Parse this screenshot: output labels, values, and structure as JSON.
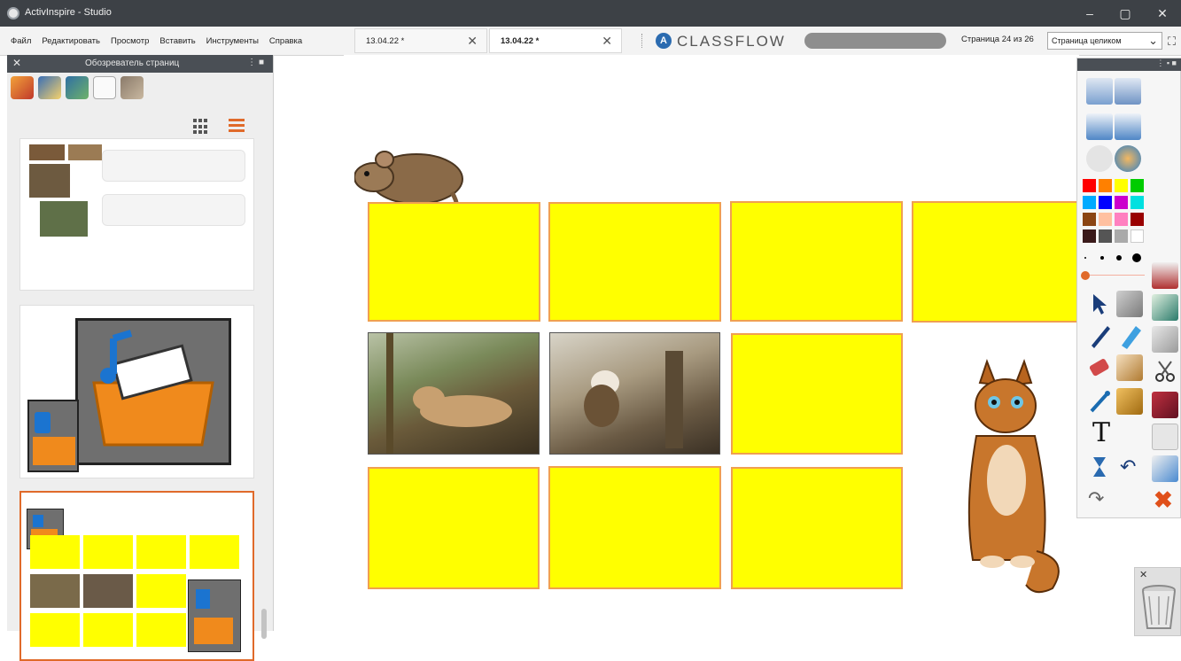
{
  "window": {
    "title": "ActivInspire - Studio",
    "controls": {
      "minimize": "–",
      "maximize": "▢",
      "close": "✕"
    }
  },
  "menu": {
    "items": [
      {
        "label": "Файл"
      },
      {
        "label": "Редактировать"
      },
      {
        "label": "Просмотр"
      },
      {
        "label": "Вставить"
      },
      {
        "label": "Инструменты"
      },
      {
        "label": "Справка"
      }
    ]
  },
  "tabs": [
    {
      "label": "13.04.22 *",
      "close": "✕",
      "active": false
    },
    {
      "label": "13.04.22 *",
      "close": "✕",
      "active": true
    }
  ],
  "classflow": {
    "logo_text": "CLASSFLOW",
    "logo_glyph": "A"
  },
  "status": {
    "page_text": "Страница 24 из 26",
    "zoom_value": "Страница целиком"
  },
  "sidebar": {
    "title": "Обозреватель страниц",
    "close": "✕",
    "pin": "⋮ ■",
    "tool_icons": [
      "page-browser-icon",
      "resource-browser-icon",
      "object-browser-icon",
      "notes-browser-icon",
      "property-browser-icon"
    ],
    "view_icons": [
      "grid-view-icon",
      "list-view-icon"
    ]
  },
  "toolbox": {
    "pin": "⋮ ▪ ■",
    "palette": [
      "#ff0000",
      "#ff8000",
      "#ffff00",
      "#00cc00",
      "#00aaff",
      "#0000ff",
      "#cc00cc",
      "#00e0e0",
      "#8b4513",
      "#ffc0a0",
      "#ff80c0",
      "#990000",
      "#3a1a1a",
      "#555555",
      "#aaaaaa",
      "#ffffff"
    ],
    "text_tool": "T"
  },
  "trash": {
    "close": "✕"
  }
}
